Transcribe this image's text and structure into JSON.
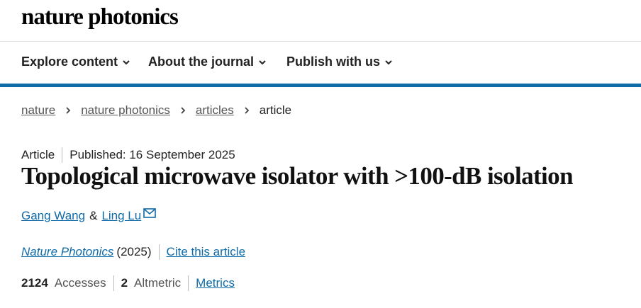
{
  "site": {
    "logo": "nature photonics"
  },
  "nav": {
    "items": [
      {
        "label": "Explore content"
      },
      {
        "label": "About the journal"
      },
      {
        "label": "Publish with us"
      }
    ]
  },
  "breadcrumb": {
    "links": [
      "nature",
      "nature photonics",
      "articles"
    ],
    "current": "article"
  },
  "article": {
    "type": "Article",
    "published": "Published: 16 September 2025",
    "title": "Topological microwave isolator with >100-dB isolation",
    "authors": [
      "Gang Wang",
      "Ling Lu"
    ],
    "author_separator": "&",
    "journal": "Nature Photonics",
    "year": "(2025)",
    "cite_label": "Cite this article"
  },
  "metrics": {
    "accesses_value": "2124",
    "accesses_label": "Accesses",
    "altmetric_value": "2",
    "altmetric_label": "Altmetric",
    "metrics_link": "Metrics"
  },
  "colors": {
    "accent": "#0f6ba8",
    "link": "#0f6ba8",
    "text": "#222222"
  },
  "icons": {
    "nav_chevron": "chevron-down-icon",
    "breadcrumb_separator": "chevron-right-icon",
    "author_contact": "mail-icon"
  }
}
